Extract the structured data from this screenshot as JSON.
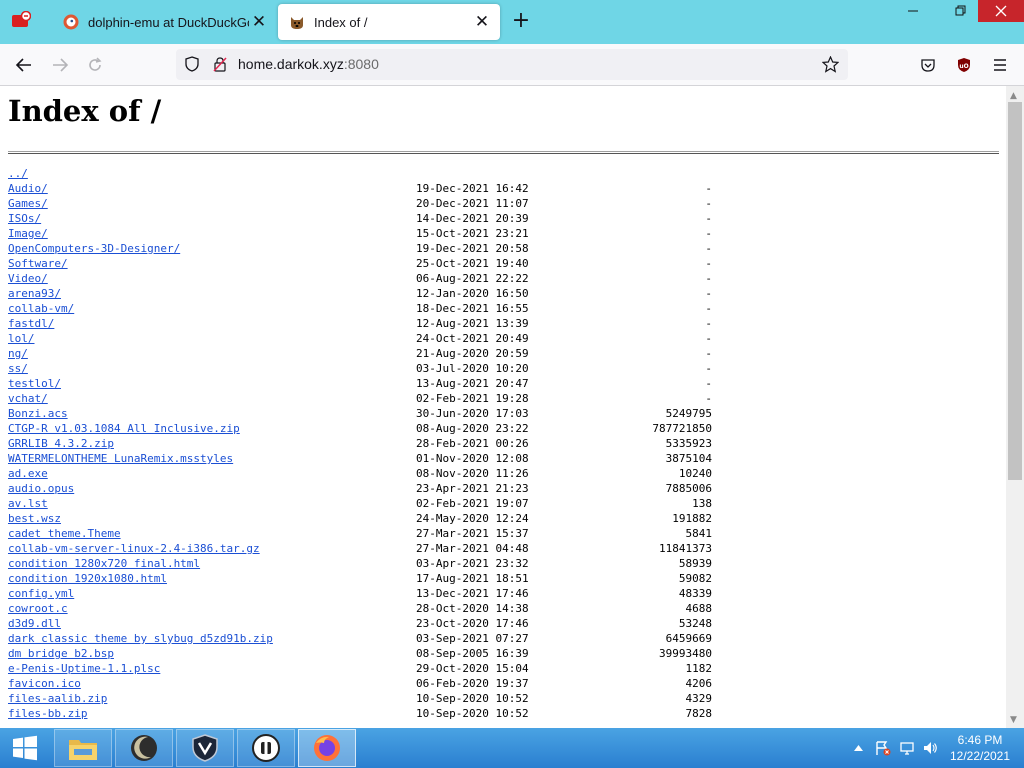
{
  "browser": {
    "tabs": [
      {
        "title": "dolphin-emu at DuckDuckGo",
        "active": false
      },
      {
        "title": "Index of /",
        "active": true
      }
    ],
    "url": {
      "host": "home.darkok.xyz",
      "port": ":8080"
    }
  },
  "page": {
    "heading": "Index of /",
    "parent_link": "../",
    "entries": [
      {
        "name": "Audio/",
        "date": "19-Dec-2021 16:42",
        "size": "-"
      },
      {
        "name": "Games/",
        "date": "20-Dec-2021 11:07",
        "size": "-"
      },
      {
        "name": "ISOs/",
        "date": "14-Dec-2021 20:39",
        "size": "-"
      },
      {
        "name": "Image/",
        "date": "15-Oct-2021 23:21",
        "size": "-"
      },
      {
        "name": "OpenComputers-3D-Designer/",
        "date": "19-Dec-2021 20:58",
        "size": "-"
      },
      {
        "name": "Software/",
        "date": "25-Oct-2021 19:40",
        "size": "-"
      },
      {
        "name": "Video/",
        "date": "06-Aug-2021 22:22",
        "size": "-"
      },
      {
        "name": "arena93/",
        "date": "12-Jan-2020 16:50",
        "size": "-"
      },
      {
        "name": "collab-vm/",
        "date": "18-Dec-2021 16:55",
        "size": "-"
      },
      {
        "name": "fastdl/",
        "date": "12-Aug-2021 13:39",
        "size": "-"
      },
      {
        "name": "lol/",
        "date": "24-Oct-2021 20:49",
        "size": "-"
      },
      {
        "name": "ng/",
        "date": "21-Aug-2020 20:59",
        "size": "-"
      },
      {
        "name": "ss/",
        "date": "03-Jul-2020 10:20",
        "size": "-"
      },
      {
        "name": "testlol/",
        "date": "13-Aug-2021 20:47",
        "size": "-"
      },
      {
        "name": "vchat/",
        "date": "02-Feb-2021 19:28",
        "size": "-"
      },
      {
        "name": "Bonzi.acs",
        "date": "30-Jun-2020 17:03",
        "size": "5249795"
      },
      {
        "name": "CTGP-R v1.03.1084 All Inclusive.zip",
        "date": "08-Aug-2020 23:22",
        "size": "787721850"
      },
      {
        "name": "GRRLIB 4.3.2.zip",
        "date": "28-Feb-2021 00:26",
        "size": "5335923"
      },
      {
        "name": "WATERMELONTHEME LunaRemix.msstyles",
        "date": "01-Nov-2020 12:08",
        "size": "3875104"
      },
      {
        "name": "ad.exe",
        "date": "08-Nov-2020 11:26",
        "size": "10240"
      },
      {
        "name": "audio.opus",
        "date": "23-Apr-2021 21:23",
        "size": "7885006"
      },
      {
        "name": "av.lst",
        "date": "02-Feb-2021 19:07",
        "size": "138"
      },
      {
        "name": "best.wsz",
        "date": "24-May-2020 12:24",
        "size": "191882"
      },
      {
        "name": "cadet theme.Theme",
        "date": "27-Mar-2021 15:37",
        "size": "5841"
      },
      {
        "name": "collab-vm-server-linux-2.4-i386.tar.gz",
        "date": "27-Mar-2021 04:48",
        "size": "11841373"
      },
      {
        "name": "condition 1280x720 final.html",
        "date": "03-Apr-2021 23:32",
        "size": "58939"
      },
      {
        "name": "condition 1920x1080.html",
        "date": "17-Aug-2021 18:51",
        "size": "59082"
      },
      {
        "name": "config.yml",
        "date": "13-Dec-2021 17:46",
        "size": "48339"
      },
      {
        "name": "cowroot.c",
        "date": "28-Oct-2020 14:38",
        "size": "4688"
      },
      {
        "name": "d3d9.dll",
        "date": "23-Oct-2020 17:46",
        "size": "53248"
      },
      {
        "name": "dark classic theme by slybug d5zd91b.zip",
        "date": "03-Sep-2021 07:27",
        "size": "6459669"
      },
      {
        "name": "dm bridge b2.bsp",
        "date": "08-Sep-2005 16:39",
        "size": "39993480"
      },
      {
        "name": "e-Penis-Uptime-1.1.plsc",
        "date": "29-Oct-2020 15:04",
        "size": "1182"
      },
      {
        "name": "favicon.ico",
        "date": "06-Feb-2020 19:37",
        "size": "4206"
      },
      {
        "name": "files-aalib.zip",
        "date": "10-Sep-2020 10:52",
        "size": "4329"
      },
      {
        "name": "files-bb.zip",
        "date": "10-Sep-2020 10:52",
        "size": "7828"
      }
    ]
  },
  "taskbar": {
    "clock_time": "6:46 PM",
    "clock_date": "12/22/2021",
    "accent": "#2a7fd0"
  },
  "icons": [
    "app-menu-icon",
    "duckduckgo-icon",
    "dog-favicon-icon",
    "close-icon",
    "new-tab-icon",
    "minimize-icon",
    "restore-icon",
    "back-icon",
    "forward-icon",
    "reload-icon",
    "shield-icon",
    "lock-icon",
    "bookmark-star-icon",
    "pocket-icon",
    "ublock-icon",
    "hamburger-menu-icon",
    "windows-start-icon",
    "file-explorer-icon",
    "moon-app-icon",
    "shield-app-icon",
    "helmet-app-icon",
    "firefox-icon"
  ]
}
